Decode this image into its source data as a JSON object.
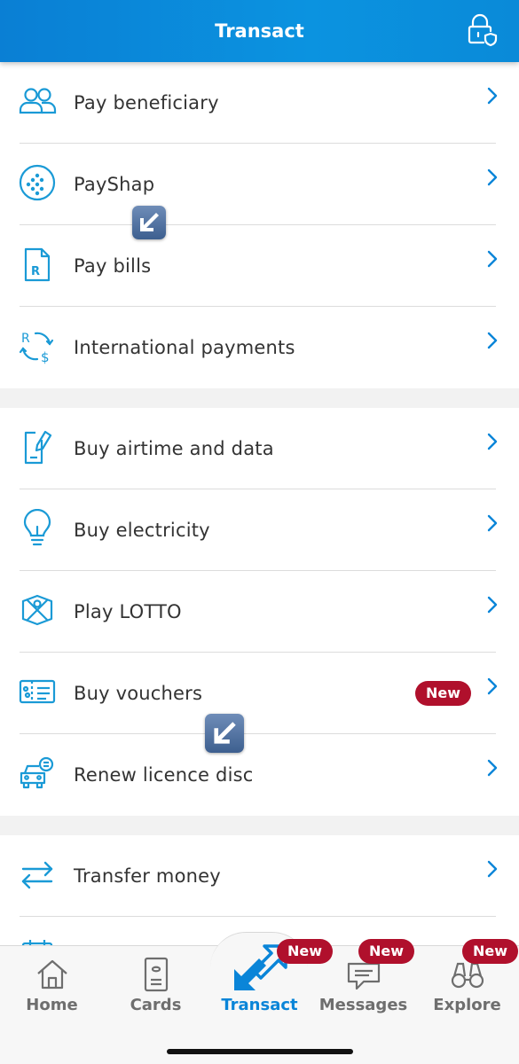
{
  "header": {
    "title": "Transact",
    "lock_icon": "lock-shield-icon"
  },
  "sections": [
    [
      {
        "id": "pay-beneficiary",
        "label": "Pay beneficiary",
        "icon": "people-icon"
      },
      {
        "id": "payshap",
        "label": "PayShap",
        "icon": "payshap-icon"
      },
      {
        "id": "pay-bills",
        "label": "Pay bills",
        "icon": "bill-icon"
      },
      {
        "id": "international-payments",
        "label": "International payments",
        "icon": "currency-exchange-icon"
      }
    ],
    [
      {
        "id": "buy-airtime",
        "label": "Buy airtime and data",
        "icon": "phone-edit-icon"
      },
      {
        "id": "buy-electricity",
        "label": "Buy electricity",
        "icon": "bulb-icon"
      },
      {
        "id": "play-lotto",
        "label": "Play LOTTO",
        "icon": "lotto-icon"
      },
      {
        "id": "buy-vouchers",
        "label": "Buy vouchers",
        "icon": "voucher-icon",
        "badge": "New"
      },
      {
        "id": "renew-licence",
        "label": "Renew licence disc",
        "icon": "car-icon"
      }
    ],
    [
      {
        "id": "transfer-money",
        "label": "Transfer money",
        "icon": "transfer-arrows-icon"
      },
      {
        "id": "scheduled",
        "label": "",
        "icon": "calendar-icon"
      }
    ]
  ],
  "tabs": [
    {
      "id": "home",
      "label": "Home",
      "icon": "home-icon"
    },
    {
      "id": "cards",
      "label": "Cards",
      "icon": "card-icon"
    },
    {
      "id": "transact",
      "label": "Transact",
      "icon": "transact-arrows-icon",
      "badge": "New",
      "active": true
    },
    {
      "id": "messages",
      "label": "Messages",
      "icon": "message-icon",
      "badge": "New"
    },
    {
      "id": "explore",
      "label": "Explore",
      "icon": "binoculars-icon",
      "badge": "New"
    }
  ],
  "colors": {
    "header": "#0a8ad8",
    "accent": "#0a85d8",
    "badge": "#b0102c",
    "icon": "#1a9ad6"
  }
}
